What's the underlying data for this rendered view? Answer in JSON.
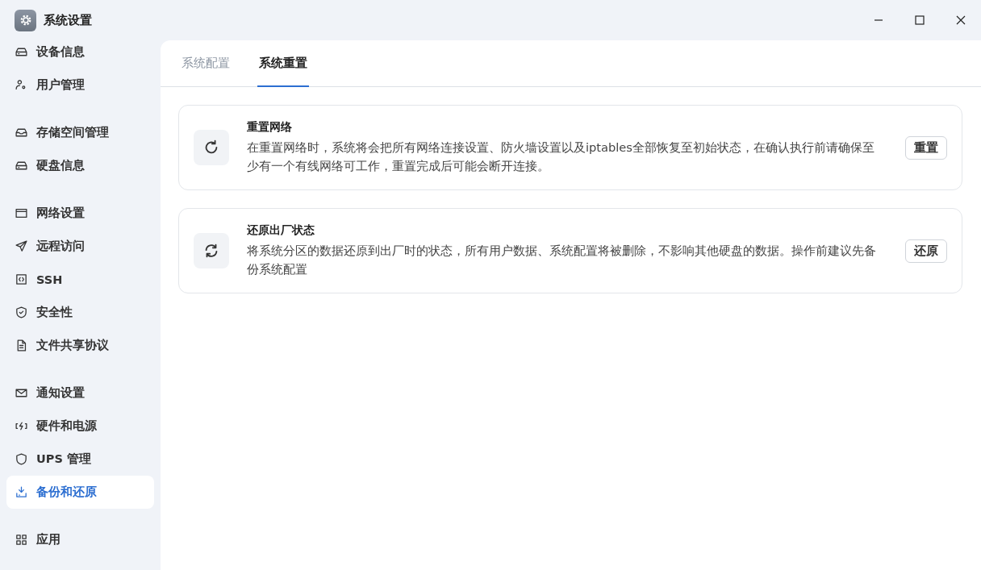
{
  "window": {
    "title": "系统设置"
  },
  "sidebar": {
    "groups": [
      {
        "items": [
          {
            "label": "设备信息",
            "selected": false
          },
          {
            "label": "用户管理",
            "selected": false
          }
        ]
      },
      {
        "items": [
          {
            "label": "存储空间管理",
            "selected": false
          },
          {
            "label": "硬盘信息",
            "selected": false
          }
        ]
      },
      {
        "items": [
          {
            "label": "网络设置",
            "selected": false
          },
          {
            "label": "远程访问",
            "selected": false
          },
          {
            "label": "SSH",
            "selected": false
          },
          {
            "label": "安全性",
            "selected": false
          },
          {
            "label": "文件共享协议",
            "selected": false
          }
        ]
      },
      {
        "items": [
          {
            "label": "通知设置",
            "selected": false
          },
          {
            "label": "硬件和电源",
            "selected": false
          },
          {
            "label": "UPS 管理",
            "selected": false
          },
          {
            "label": "备份和还原",
            "selected": true
          }
        ]
      },
      {
        "items": [
          {
            "label": "应用",
            "selected": false
          }
        ]
      }
    ]
  },
  "tabs": [
    {
      "label": "系统配置",
      "selected": false
    },
    {
      "label": "系统重置",
      "selected": true
    }
  ],
  "cards": [
    {
      "title": "重置网络",
      "description": "在重置网络时，系统将会把所有网络连接设置、防火墙设置以及iptables全部恢复至初始状态，在确认执行前请确保至少有一个有线网络可工作，重置完成后可能会断开连接。",
      "button": "重置"
    },
    {
      "title": "还原出厂状态",
      "description": "将系统分区的数据还原到出厂时的状态，所有用户数据、系统配置将被删除，不影响其他硬盘的数据。操作前建议先备份系统配置",
      "button": "还原"
    }
  ]
}
